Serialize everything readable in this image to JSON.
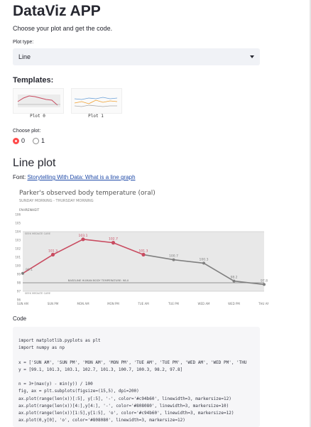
{
  "app": {
    "title": "DataViz APP",
    "subtitle": "Choose your plot and get the code."
  },
  "plot_type": {
    "label": "Plot type:",
    "value": "Line"
  },
  "templates": {
    "heading": "Templates:",
    "items": [
      {
        "caption": "Plot 0"
      },
      {
        "caption": "Plot 1"
      }
    ]
  },
  "choose_plot": {
    "label": "Choose plot:",
    "options": [
      "0",
      "1"
    ],
    "selected": "0"
  },
  "section": {
    "heading": "Line plot",
    "font_prefix": "Font: ",
    "font_link": "Storytelling With Data: What is a line graph"
  },
  "chart_data": {
    "type": "line",
    "title": "Parker's observed body temperature (oral)",
    "subtitle": "SUNDAY MORNING - THURSDAY MORNING",
    "ylabel": "FAHRENHEIT",
    "categories": [
      "SUN AM",
      "SUN PM",
      "MON AM",
      "MON PM",
      "TUE AM",
      "TUE PM",
      "WED AM",
      "WED PM",
      "THU AM"
    ],
    "values": [
      99.1,
      101.3,
      103.1,
      102.7,
      101.3,
      100.7,
      100.3,
      98.2,
      97.8
    ],
    "value_labels": [
      "99.1",
      "101.3",
      "103.1",
      "102.7",
      "101.3",
      "100.7",
      "100.3",
      "98.2",
      "97.8"
    ],
    "ylim": [
      96,
      106
    ],
    "yticks": [
      "96",
      "97",
      "98",
      "99",
      "100",
      "101",
      "102",
      "103",
      "104",
      "105",
      "106"
    ],
    "band": [
      97,
      104
    ],
    "band_top_label": "SEEK MEDIATE CARE",
    "band_bottom_label": "SEEK MEDIATE CARE",
    "baseline": 98,
    "baseline_label": "BASELINE HUMAN BODY TEMPERATURE: 98.0",
    "colors": {
      "highlight": "#c94b60",
      "rest": "#808080",
      "band": "#e8e8e8",
      "text": "#555555"
    }
  },
  "code": {
    "label": "Code",
    "lines": [
      "import matplotlib.pyplots as plt",
      "import numpy as np",
      "",
      "x = ['SUN AM', 'SUN PM', 'MON AM', 'MON PM', 'TUE AM', 'TUE PM', 'WED AM', 'WED PM', 'THU",
      "y = [99.1, 101.3, 103.1, 102.7, 101.3, 100.7, 100.3, 98.2, 97.8]",
      "",
      "n = 3+(max(y) - min(y)) / 100",
      "fig, ax = plt.subplots(figsize=(15,5), dpi=200)",
      "ax.plot(range(len(x))[:5], y[:5], '-', color='#c94b60', linewidth=3, markersize=12)",
      "ax.plot(range(len(x))[4:],y[4:], '-', color='#808080', linewidth=3, markersize=10)",
      "ax.plot(range(len(x))[1:5],y[1:5], 'o', color='#c94b60', linewidth=3, markersize=12)",
      "ax.plot(0,y[0], 'o', color='#808080', linewidth=3, markersize=12)"
    ]
  }
}
